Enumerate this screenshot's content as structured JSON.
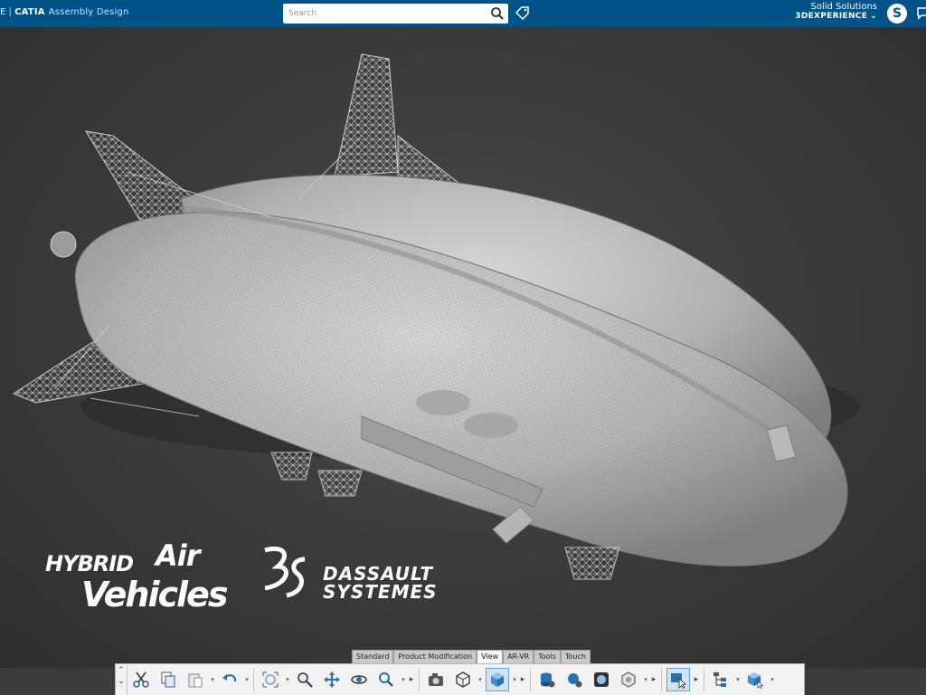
{
  "header": {
    "brand_fragment": "E",
    "separator": "|",
    "app_name": "CATIA",
    "module_name": "Assembly Design",
    "search_placeholder": "Search",
    "company": "Solid Solutions",
    "platform": "3DEXPERIENCE",
    "avatar_letter": "S"
  },
  "logos": {
    "hav_line1": "HYBRID",
    "hav_air": "Air",
    "hav_line2": "Vehicles",
    "ds_line1": "DASSAULT",
    "ds_line2": "SYSTEMES"
  },
  "action_bar": {
    "tabs": [
      "Standard",
      "Product Modification",
      "View",
      "AR-VR",
      "Tools",
      "Touch"
    ],
    "active_tab": "View",
    "tools": [
      "cut-icon",
      "copy-icon",
      "paste-icon",
      "undo-icon",
      "fit-all-icon",
      "zoom-area-icon",
      "pan-icon",
      "rotate-icon",
      "zoom-icon",
      "capture-icon",
      "view-mode-icon",
      "shading-icon",
      "render-icon",
      "ambience-icon",
      "lighting-icon",
      "normal-view-icon",
      "select-icon",
      "tree-icon",
      "product-icon"
    ]
  },
  "colors": {
    "topbar": "#005386",
    "viewport": "#3b3b3b",
    "model": "#bdbdbd"
  }
}
